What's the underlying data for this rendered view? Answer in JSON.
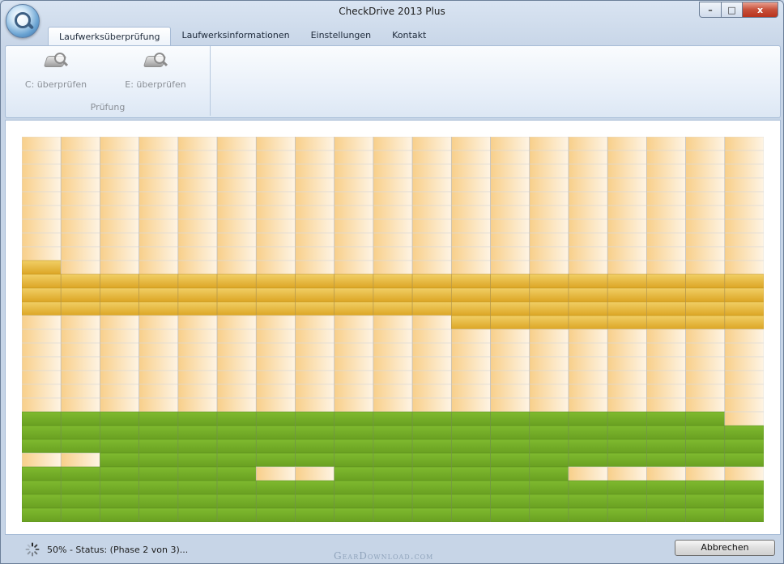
{
  "window": {
    "title": "CheckDrive 2013 Plus",
    "controls": {
      "minimize": "–",
      "maximize": "□",
      "close": "x"
    }
  },
  "tabs": [
    {
      "label": "Laufwerksüberprüfung",
      "active": true
    },
    {
      "label": "Laufwerksinformationen",
      "active": false
    },
    {
      "label": "Einstellungen",
      "active": false
    },
    {
      "label": "Kontakt",
      "active": false
    }
  ],
  "ribbon": {
    "group_title": "Prüfung",
    "buttons": [
      {
        "label": "C: überprüfen",
        "icon": "drive-search-icon",
        "enabled": false
      },
      {
        "label": "E: überprüfen",
        "icon": "drive-search-icon",
        "enabled": false
      }
    ]
  },
  "scan_map": {
    "columns": 19,
    "rows": 28,
    "colors": {
      "pending": "#f8cf8a",
      "pending_light": "#fdf2e0",
      "scanning": "#e7b83a",
      "ok": "#74ae28",
      "border": "#d9d9d9"
    },
    "scanning_rows_all": [
      10,
      11,
      12
    ],
    "scanning_extra": [
      [
        9,
        0
      ],
      [
        13,
        11
      ],
      [
        13,
        12
      ],
      [
        13,
        13
      ],
      [
        13,
        14
      ],
      [
        13,
        15
      ],
      [
        13,
        16
      ],
      [
        13,
        17
      ],
      [
        13,
        18
      ]
    ],
    "ok_rows_all": [
      20,
      21,
      22,
      23,
      24,
      25,
      26,
      27
    ],
    "ok_extra": [
      [
        20,
        18
      ]
    ],
    "ok_excluded": [
      [
        20,
        18
      ],
      [
        23,
        0
      ],
      [
        23,
        1
      ],
      [
        24,
        6
      ],
      [
        24,
        7
      ],
      [
        24,
        14
      ],
      [
        24,
        15
      ],
      [
        24,
        16
      ],
      [
        24,
        17
      ],
      [
        24,
        18
      ]
    ]
  },
  "status": {
    "text": "50% - Status: (Phase 2 von 3)...",
    "progress_percent": 50
  },
  "cancel_label": "Abbrechen",
  "watermark": "GearDownload.com"
}
